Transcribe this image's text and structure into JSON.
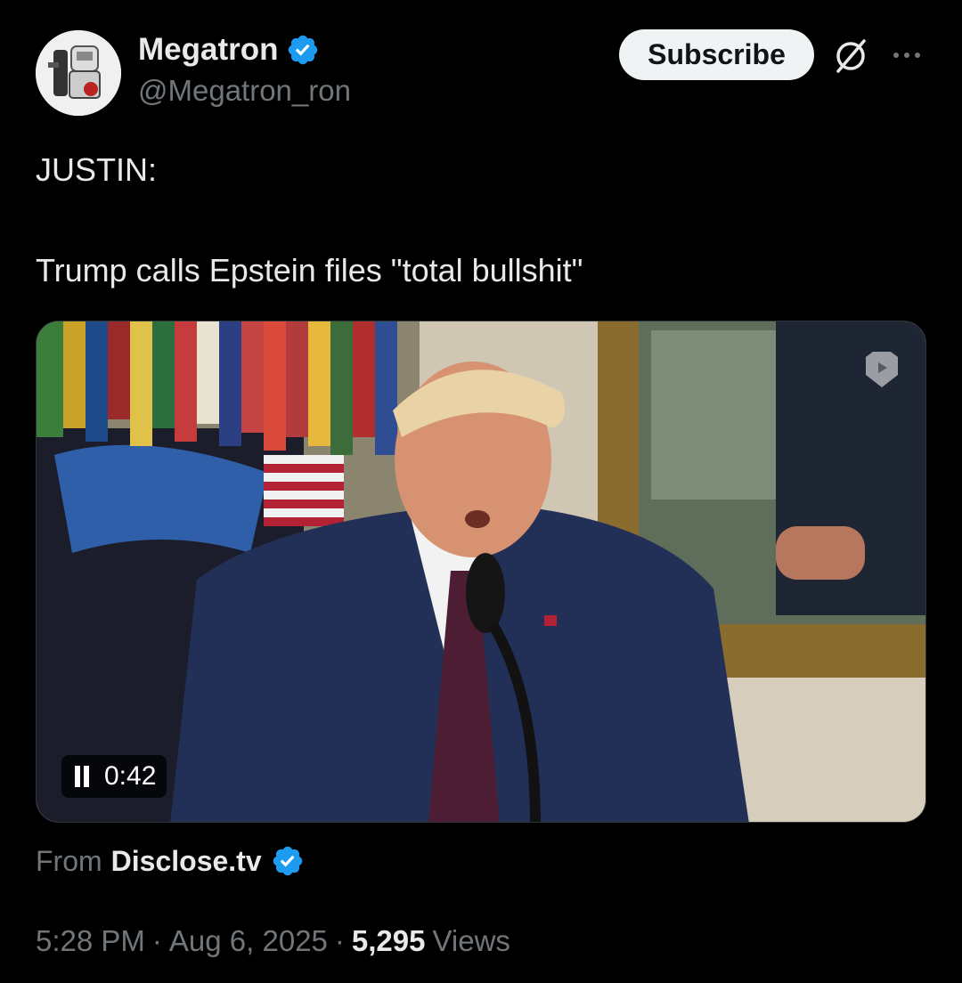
{
  "author": {
    "name": "Megatron",
    "handle": "@Megatron_ron",
    "verified": true
  },
  "actions": {
    "subscribe_label": "Subscribe",
    "grok_icon": "grok-icon",
    "more_icon": "more-dots-icon"
  },
  "tweet": {
    "line1": "JUSTIN:",
    "line2": "Trump calls Epstein files \"total bullshit\""
  },
  "media": {
    "type": "video",
    "timestamp": "0:42",
    "state": "playing"
  },
  "source": {
    "prefix": "From",
    "name": "Disclose.tv",
    "verified": true
  },
  "meta": {
    "time": "5:28 PM",
    "sep1": "·",
    "date": "Aug 6, 2025",
    "sep2": "·",
    "views_count": "5,295",
    "views_label": "Views"
  },
  "colors": {
    "background": "#000000",
    "text_primary": "#e7e9ea",
    "text_secondary": "#71767b",
    "verified_blue": "#1d9bf0",
    "subscribe_bg": "#eff3f4"
  }
}
